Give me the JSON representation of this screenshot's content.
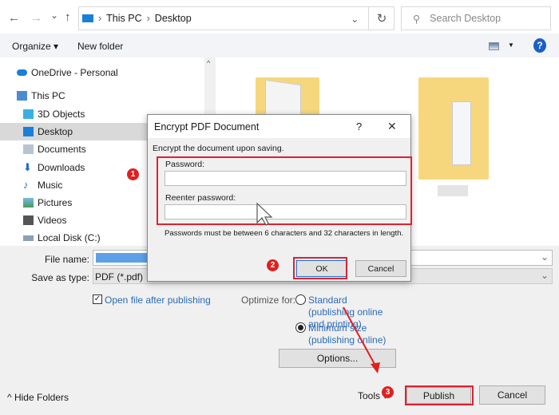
{
  "nav_bar": {
    "back": "←",
    "forward": "→",
    "recent": "⌄",
    "up": "↑",
    "breadcrumb": [
      "This PC",
      "Desktop"
    ],
    "refresh": "↻",
    "search_placeholder": "Search Desktop"
  },
  "toolbar": {
    "organize": "Organize ▾",
    "new_folder": "New folder",
    "help": "?"
  },
  "sidebar": {
    "items": [
      {
        "label": "OneDrive - Personal",
        "icon": "cloud-icon"
      },
      {
        "label": "This PC",
        "icon": "computer-icon"
      },
      {
        "label": "3D Objects",
        "icon": "cube-icon"
      },
      {
        "label": "Desktop",
        "icon": "desktop-icon",
        "selected": true
      },
      {
        "label": "Documents",
        "icon": "document-icon"
      },
      {
        "label": "Downloads",
        "icon": "download-icon"
      },
      {
        "label": "Music",
        "icon": "music-icon"
      },
      {
        "label": "Pictures",
        "icon": "picture-icon"
      },
      {
        "label": "Videos",
        "icon": "video-icon"
      },
      {
        "label": "Local Disk (C:)",
        "icon": "disk-icon"
      }
    ]
  },
  "form": {
    "file_name_label": "File name:",
    "file_name_value": "",
    "save_type_label": "Save as type:",
    "save_type_value": "PDF (*.pdf)",
    "open_after_label": "Open file after publishing",
    "open_after_checked": true,
    "optimize_label": "Optimize for:",
    "standard_label": "Standard (publishing online and printing)",
    "minimum_label": "Minimum size (publishing online)",
    "selected_optimize": "minimum",
    "options_button": "Options...",
    "hide_folders": "Hide Folders",
    "tools": "Tools ▾",
    "publish": "Publish",
    "cancel": "Cancel"
  },
  "dialog": {
    "title": "Encrypt PDF Document",
    "help": "?",
    "close": "✕",
    "intro": "Encrypt the document upon saving.",
    "password_label": "Password:",
    "reenter_label": "Reenter password:",
    "note": "Passwords must be between 6 characters and 32 characters in length.",
    "ok": "OK",
    "cancel": "Cancel"
  },
  "annotations": {
    "step1": "1",
    "step2": "2",
    "step3": "3",
    "highlight_color": "#e02030"
  }
}
